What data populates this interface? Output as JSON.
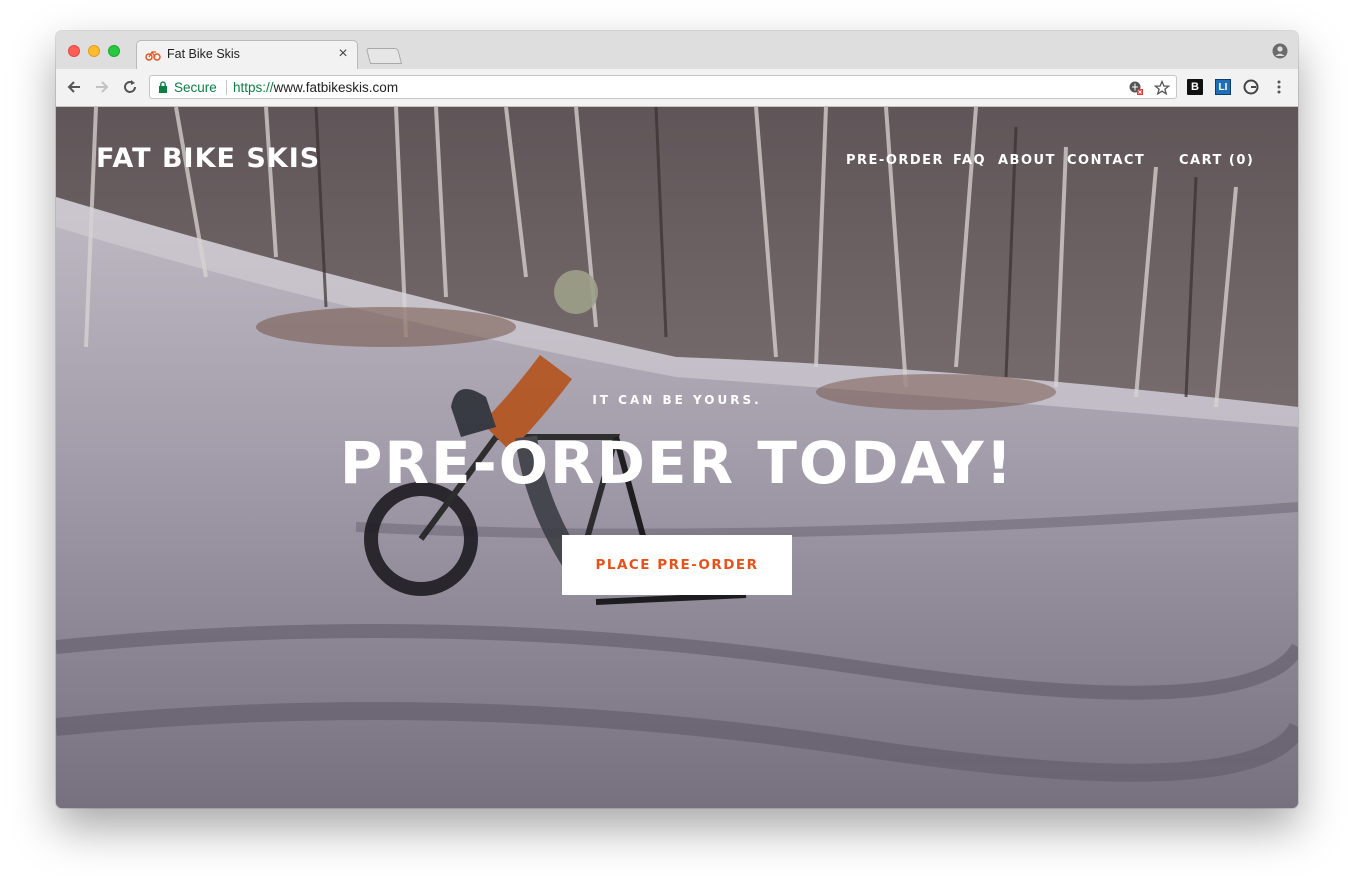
{
  "browser": {
    "tab": {
      "title": "Fat Bike Skis",
      "close_glyph": "×",
      "favicon": "bike-favicon-icon"
    },
    "toolbar": {
      "secure_label": "Secure",
      "url_scheme": "https://",
      "url_host": "www.fatbikeskis.com",
      "extensions": [
        "B",
        "LI",
        "G"
      ]
    }
  },
  "site": {
    "title": "FAT BIKE SKIS",
    "nav": {
      "preorder": "PRE-ORDER",
      "faq": "FAQ",
      "about": "ABOUT",
      "contact": "CONTACT",
      "cart": "CART (0)"
    },
    "hero": {
      "kicker": "IT CAN BE YOURS.",
      "heading": "PRE-ORDER TODAY!",
      "cta_label": "PLACE PRE-ORDER"
    }
  },
  "colors": {
    "accent": "#e8521a",
    "secure_green": "#0b8043"
  }
}
